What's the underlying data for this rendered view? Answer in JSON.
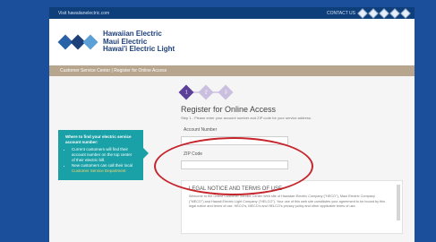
{
  "topbar": {
    "left_text": "Visit hawaiianelectric.com",
    "contact_label": "CONTACT US",
    "icons": [
      "diamond-icon",
      "diamond-icon",
      "diamond-icon",
      "diamond-icon",
      "diamond-icon"
    ]
  },
  "logo": {
    "line1": "Hawaiian Electric",
    "line2": "Maui Electric",
    "line3": "Hawai'i Electric Light",
    "colors": [
      "#2a62a8",
      "#1d3f7a",
      "#5ba0d6"
    ]
  },
  "breadcrumb": "Customer Service Center | Register for Online Access",
  "steps": [
    {
      "label": "1",
      "color": "#5b3f99"
    },
    {
      "label": "2",
      "color": "#cbbfe0"
    },
    {
      "label": "3",
      "color": "#cbbfe0"
    }
  ],
  "form": {
    "title": "Register for Online Access",
    "subtitle": "Step 1 - Please enter your account number and ZIP code for your service address.",
    "account_label": "Account Number",
    "zip_label": "ZIP Code"
  },
  "help": {
    "heading": "Where to find your electric service account number:",
    "bullet1": "Current customers will find their account number on the top center of their electric bill.",
    "bullet2": "New customers can call their local",
    "bullet2_link": "Customer Service Department"
  },
  "legal": {
    "heading": "LEGAL NOTICE AND TERMS OF USE",
    "text": "Welcome to the Online Customer Service Center Web site of Hawaiian Electric Company (\"HECO\"), Maui Electric Company (\"MECO\") and Hawaii Electric Light Company (\"HELCO\"). Your use of this web site constitutes your agreement to be bound by this legal notice and terms of use. HECO's, MECO's and HELCO's privacy policy and other applicable terms of use."
  },
  "annotation_color": "#c6242b"
}
